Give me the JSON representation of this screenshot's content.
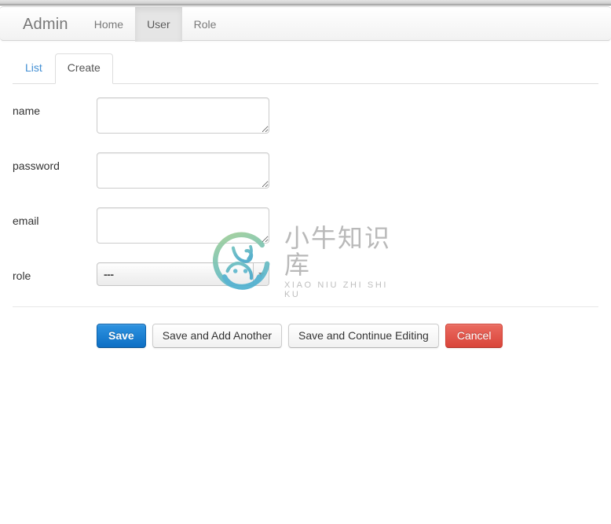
{
  "navbar": {
    "brand": "Admin",
    "items": [
      {
        "label": "Home",
        "active": false
      },
      {
        "label": "User",
        "active": true
      },
      {
        "label": "Role",
        "active": false
      }
    ]
  },
  "tabs": [
    {
      "label": "List",
      "active": false
    },
    {
      "label": "Create",
      "active": true
    }
  ],
  "form": {
    "fields": [
      {
        "label": "name",
        "type": "textarea",
        "value": "",
        "placeholder": ""
      },
      {
        "label": "password",
        "type": "textarea",
        "value": "",
        "placeholder": ""
      },
      {
        "label": "email",
        "type": "textarea",
        "value": "",
        "placeholder": ""
      },
      {
        "label": "role",
        "type": "select",
        "value": "---",
        "options": [
          "---"
        ]
      }
    ]
  },
  "actions": {
    "save": "Save",
    "save_add_another": "Save and Add Another",
    "save_continue": "Save and Continue Editing",
    "cancel": "Cancel"
  },
  "watermark": {
    "cn": "小牛知识库",
    "en": "XIAO NIU ZHI SHI KU"
  },
  "colors": {
    "primary": "#0c6ec4",
    "danger": "#d9453a",
    "link": "#4390d4",
    "logo_green": "#86c08d",
    "logo_teal": "#5bb6c9"
  }
}
